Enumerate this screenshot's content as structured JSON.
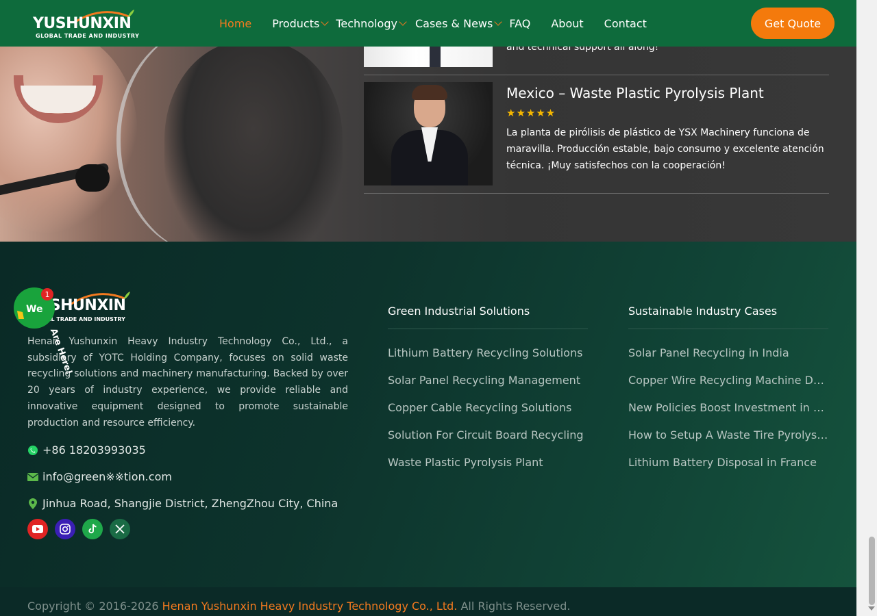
{
  "header": {
    "logo_text": "YUSHUNXIN",
    "logo_sub": "GLOBAL TRADE AND INDUSTRY",
    "nav": [
      {
        "label": "Home",
        "active": true,
        "dropdown": false
      },
      {
        "label": "Products",
        "active": false,
        "dropdown": true
      },
      {
        "label": "Technology",
        "active": false,
        "dropdown": true
      },
      {
        "label": "Cases & News",
        "active": false,
        "dropdown": true
      },
      {
        "label": "FAQ",
        "active": false,
        "dropdown": false
      },
      {
        "label": "About",
        "active": false,
        "dropdown": false
      },
      {
        "label": "Contact",
        "active": false,
        "dropdown": false
      }
    ],
    "cta_label": "Get Quote"
  },
  "testimonials": {
    "prev_text_tail": "and technical support all along!",
    "review": {
      "title": "Mexico – Waste Plastic Pyrolysis Plant",
      "stars": "★★★★★",
      "rating": 5,
      "text": "La planta de pirólisis de plástico de YSX Machinery funciona de maravilla. Producción estable, bajo consumo y excelente atención técnica. ¡Muy satisfechos con la cooperación!"
    }
  },
  "chat_widget": {
    "label_1": "We",
    "label_2": "Are Here!",
    "badge": "1"
  },
  "footer": {
    "logo_text": "YUSHUNXIN",
    "logo_sub": "GLOBAL TRADE AND INDUSTRY",
    "about": "Henan Yushunxin Heavy Industry Technology Co., Ltd., a subsidiary of YOTC Holding Company, focuses on solid waste recycling solutions and machinery manufacturing. Backed by over 20 years of industry experience, we provide reliable and innovative equipment designed to promote sustainable production and resource efficiency.",
    "phone": "+86 18203993035",
    "email": "info@green※※tion.com",
    "address": "Jinhua Road, Shangjie District, ZhengZhou City, China",
    "social": [
      "youtube-icon",
      "instagram-icon",
      "tiktok-icon",
      "x-icon"
    ],
    "col1": {
      "title": "Green Industrial Solutions",
      "links": [
        "Lithium Battery Recycling Solutions",
        "Solar Panel Recycling Management",
        "Copper Cable Recycling Solutions",
        "Solution For Circuit Board Recycling",
        "Waste Plastic Pyrolysis Plant"
      ]
    },
    "col2": {
      "title": "Sustainable Industry Cases",
      "links": [
        "Solar Panel Recycling in India",
        "Copper Wire Recycling Machine Delivered",
        "New Policies Boost Investment in Pyrolysis",
        "How to Setup A Waste Tire Pyrolysis Plant",
        "Lithium Battery Disposal in France"
      ]
    },
    "copyright_prefix": "Copyright © 2016-2026 ",
    "copyright_company": "Henan Yushunxin Heavy Industry Technology Co., Ltd.",
    "copyright_suffix": " All Rights Reserved."
  },
  "colors": {
    "header_bg": "#0e6b3c",
    "accent_orange": "#f47a0c",
    "star_gold": "#f5b700"
  }
}
